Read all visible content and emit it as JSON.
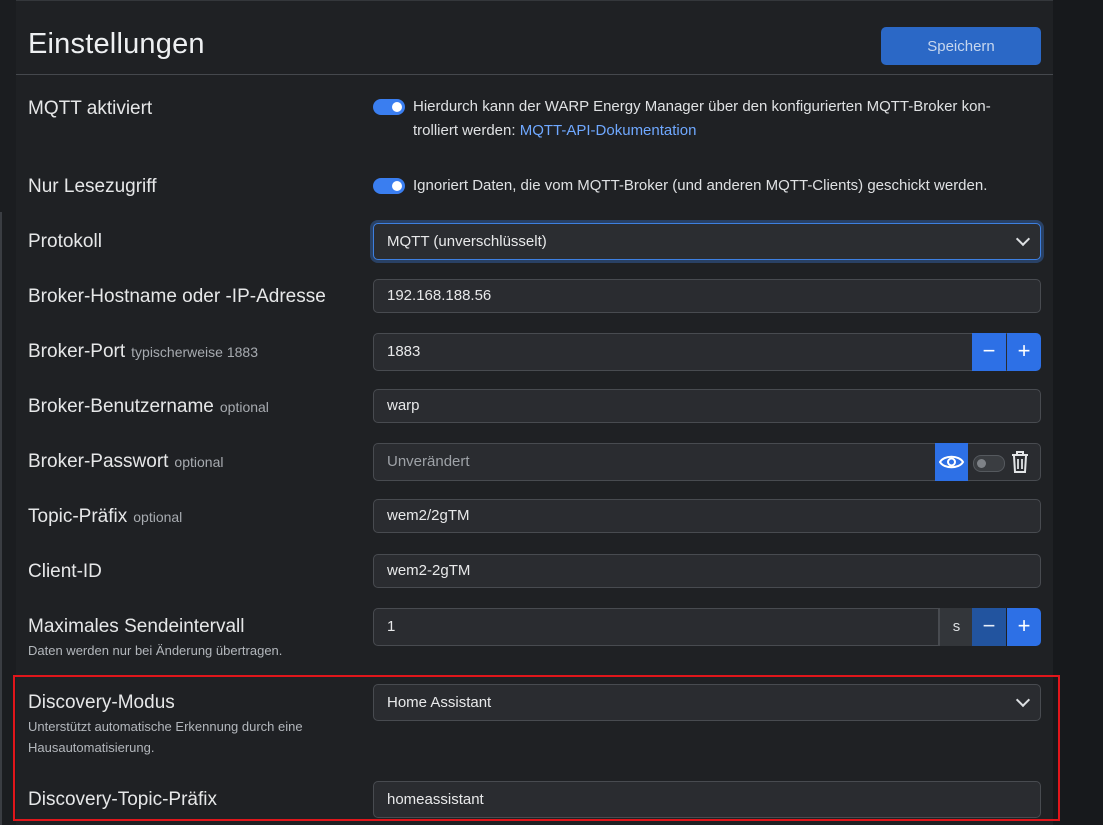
{
  "header": {
    "title": "Einstellungen",
    "save_label": "Speichern"
  },
  "mqtt_enable": {
    "label": "MQTT aktiviert",
    "enabled": true,
    "description": "Hierdurch kann der WARP Energy Manager über den konfigurierten MQTT-Broker kon-",
    "description_line2": "trolliert werden: ",
    "link": "MQTT-API-Dokumentation"
  },
  "read_only": {
    "label": "Nur Lesezugriff",
    "enabled": true,
    "description": "Ignoriert Daten, die vom MQTT-Broker (und anderen MQTT-Clients) geschickt werden."
  },
  "protocol": {
    "label": "Protokoll",
    "value": "MQTT (unverschlüsselt)"
  },
  "broker_host": {
    "label": "Broker-Hostname oder -IP-Adresse",
    "value": "192.168.188.56"
  },
  "broker_port": {
    "label": "Broker-Port",
    "hint": "typischerweise 1883",
    "value": "1883",
    "minus": "−",
    "plus": "+"
  },
  "broker_user": {
    "label": "Broker-Benutzername",
    "hint": "optional",
    "value": "warp"
  },
  "broker_password": {
    "label": "Broker-Passwort",
    "hint": "optional",
    "placeholder": "Unverändert",
    "clear_enabled": false
  },
  "topic_prefix": {
    "label": "Topic-Präfix",
    "hint": "optional",
    "value": "wem2/2gTM"
  },
  "client_id": {
    "label": "Client-ID",
    "value": "wem2-2gTM"
  },
  "send_interval": {
    "label": "Maximales Sendeintervall",
    "description": "Daten werden nur bei Änderung übertragen.",
    "value": "1",
    "unit": "s",
    "minus": "−",
    "plus": "+"
  },
  "discovery_mode": {
    "label": "Discovery-Modus",
    "description_line1": "Unterstützt automatische Erkennung durch eine",
    "description_line2": "Hausautomatisierung.",
    "value": "Home Assistant"
  },
  "discovery_prefix": {
    "label": "Discovery-Topic-Präfix",
    "value": "homeassistant"
  },
  "colors": {
    "accent": "#2d70e6",
    "highlight": "#e0161b",
    "background": "#1f2124"
  }
}
